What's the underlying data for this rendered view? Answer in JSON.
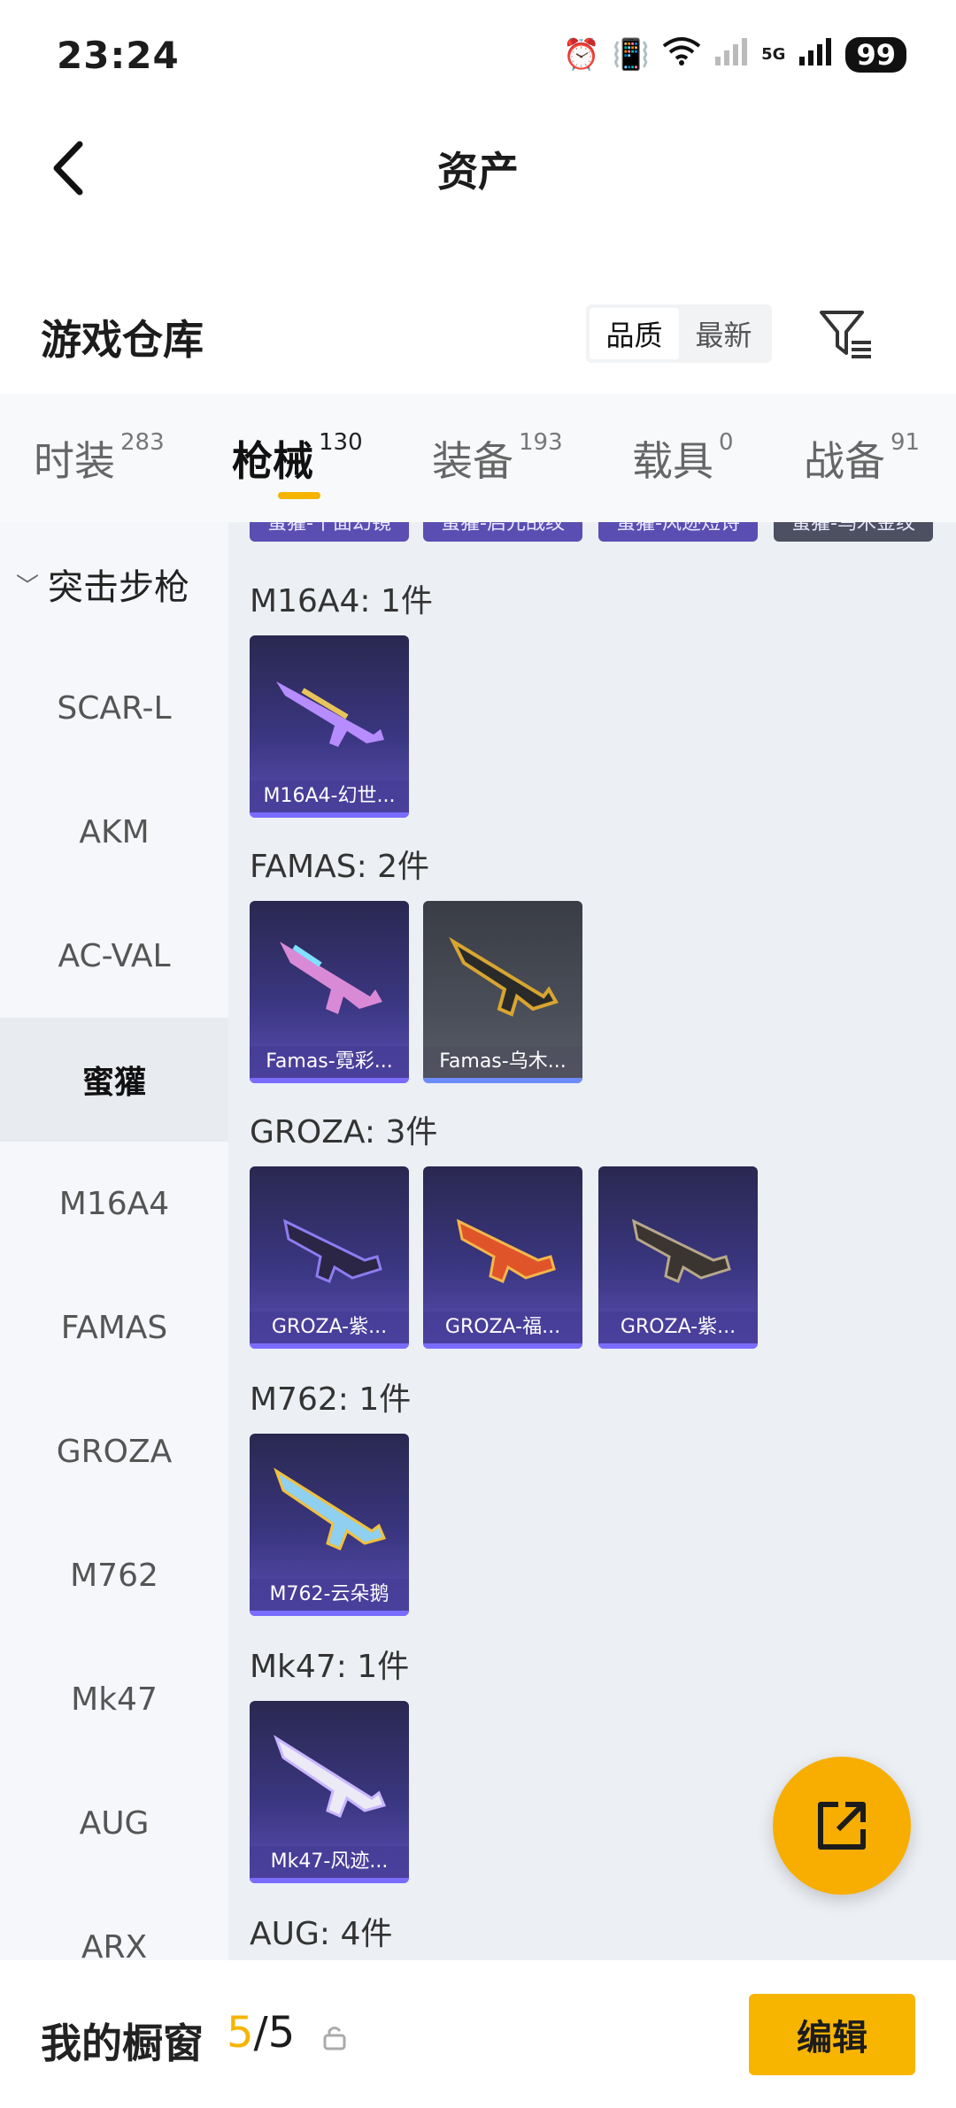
{
  "status": {
    "time": "23:24",
    "battery": "99",
    "network": "5G"
  },
  "nav": {
    "title": "资产"
  },
  "warehouse": {
    "title": "游戏仓库",
    "sort_quality": "品质",
    "sort_latest": "最新"
  },
  "tabs": [
    {
      "label": "时装",
      "count": "283"
    },
    {
      "label": "枪械",
      "count": "130"
    },
    {
      "label": "装备",
      "count": "193"
    },
    {
      "label": "载具",
      "count": "0"
    },
    {
      "label": "战备",
      "count": "91"
    }
  ],
  "sidebar": {
    "group": "突击步枪",
    "items": [
      "SCAR-L",
      "AKM",
      "AC-VAL",
      "蜜獾",
      "M16A4",
      "FAMAS",
      "GROZA",
      "M762",
      "Mk47",
      "AUG",
      "ARX"
    ]
  },
  "content": {
    "top_strip": [
      "蜜獾-千面幻镜",
      "蜜獾-启元战纹",
      "蜜獾-风迹短诗",
      "蜜獾-乌木金纹"
    ],
    "groups": [
      {
        "title": "M16A4: 1件",
        "items": [
          "M16A4-幻世..."
        ]
      },
      {
        "title": "FAMAS: 2件",
        "items": [
          "Famas-霓彩...",
          "Famas-乌木..."
        ]
      },
      {
        "title": "GROZA: 3件",
        "items": [
          "GROZA-紫...",
          "GROZA-福...",
          "GROZA-紫..."
        ]
      },
      {
        "title": "M762: 1件",
        "items": [
          "M762-云朵鹅"
        ]
      },
      {
        "title": "Mk47: 1件",
        "items": [
          "Mk47-风迹..."
        ]
      },
      {
        "title": "AUG: 4件",
        "items": []
      }
    ]
  },
  "bottom": {
    "showcase_label": "我的橱窗",
    "showcase_used": "5",
    "showcase_total": "/5",
    "edit_label": "编辑"
  },
  "colors": {
    "accent": "#F7B500",
    "card_purple": "#3A3680"
  }
}
